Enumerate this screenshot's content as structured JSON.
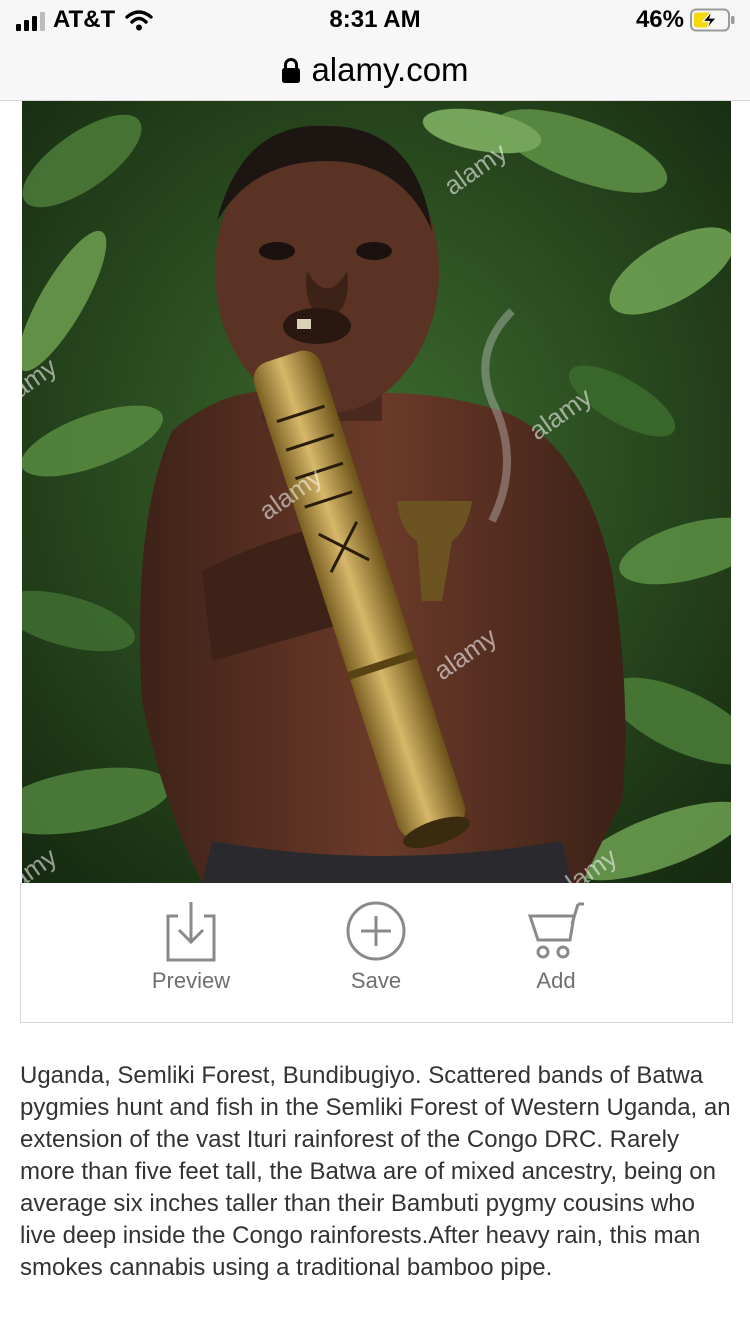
{
  "status_bar": {
    "carrier": "AT&T",
    "time": "8:31 AM",
    "battery_percent": "46%"
  },
  "url_bar": {
    "domain": "alamy.com",
    "secure_icon": "lock-icon"
  },
  "photo": {
    "watermark_text": "alamy"
  },
  "actions": [
    {
      "label": "Preview",
      "icon": "download-icon"
    },
    {
      "label": "Save",
      "icon": "plus-circle-icon"
    },
    {
      "label": "Add",
      "icon": "cart-icon"
    }
  ],
  "description": "Uganda, Semliki Forest, Bundibugiyo. Scattered bands of Batwa pygmies hunt and fish in the Semliki Forest of Western Uganda, an extension of the vast Ituri rainforest of the Congo DRC. Rarely more than five feet tall, the Batwa are of mixed ancestry, being on average six inches taller than their Bambuti pygmy cousins who live deep inside the Congo rainforests.After heavy rain, this man smokes cannabis using a traditional bamboo pipe.",
  "colors": {
    "battery_charge": "#f5d90a",
    "action_gray": "#8a8a8a",
    "foliage": "#2f5a24"
  }
}
